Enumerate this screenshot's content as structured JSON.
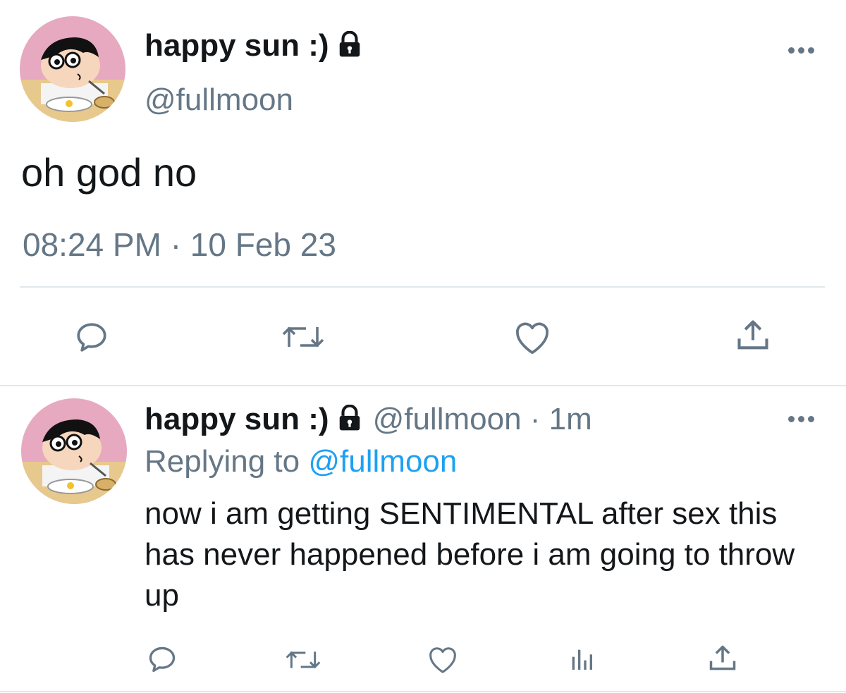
{
  "main_tweet": {
    "display_name": "happy sun :)",
    "handle": "@fullmoon",
    "text": "oh god no",
    "time": "08:24 PM",
    "separator": "·",
    "date": "10 Feb 23",
    "protected": true
  },
  "reply_tweet": {
    "display_name": "happy sun :)",
    "handle": "@fullmoon",
    "separator": "·",
    "age": "1m",
    "replying_prefix": "Replying to",
    "replying_to": "@fullmoon",
    "text": "now i am getting SENTIMENTAL after sex this has never happened before i am going to throw up",
    "protected": true
  },
  "icons": {
    "lock": "lock-icon",
    "more": "more-horizontal-icon",
    "reply": "reply-icon",
    "retweet": "retweet-icon",
    "like": "heart-icon",
    "share": "share-icon",
    "analytics": "analytics-icon"
  },
  "colors": {
    "text": "#14171a",
    "secondary": "#657786",
    "link": "#1da1f2",
    "divider": "#e1e8ed"
  }
}
